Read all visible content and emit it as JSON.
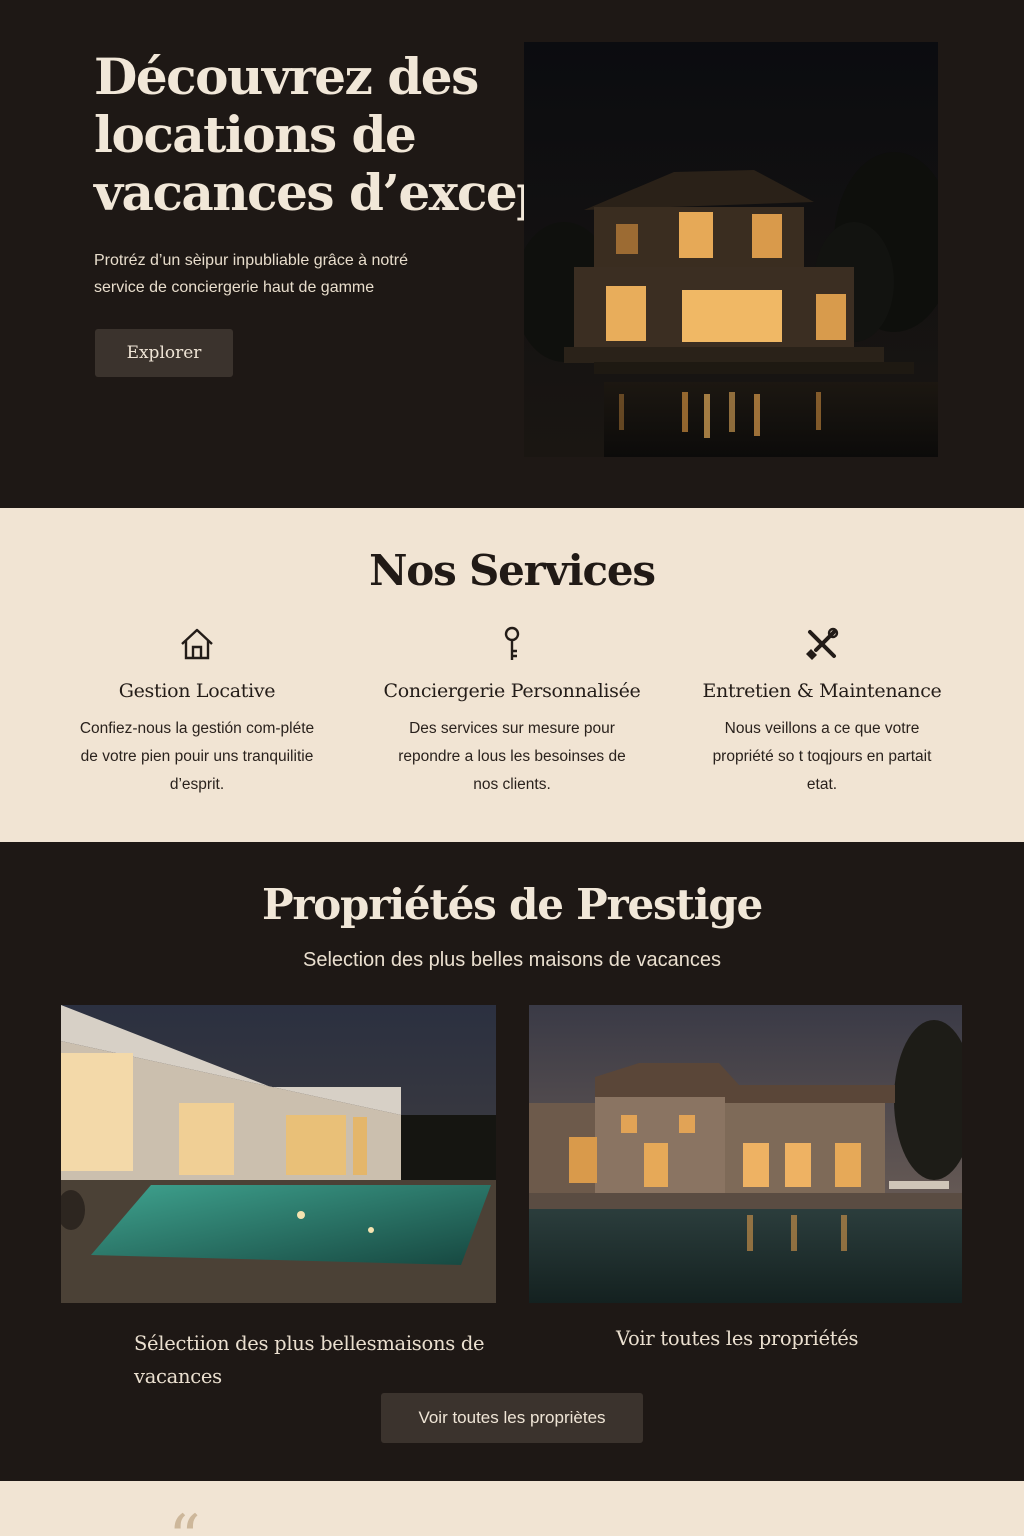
{
  "hero": {
    "title_line1": "Découvrez des",
    "title_line2": "locations de",
    "title_line3": "vacances d’exception",
    "subtitle_line1": "Protréz d’un sèipur inpubliable grâce à notré",
    "subtitle_line2": "service de conciergerie haut de gamme",
    "cta": "Explorer",
    "image_icon": "night-villa-photo"
  },
  "services": {
    "title": "Nos Services",
    "items": [
      {
        "icon": "house-icon",
        "title": "Gestion Locative",
        "desc": "Confiez-nous la gestión com-pléte de votre pien pouir uns tranquilitie d’esprit."
      },
      {
        "icon": "key-icon",
        "title": "Conciergerie Personnalisée",
        "desc": "Des services sur mesure pour repondre a lous les besoinses de nos clients."
      },
      {
        "icon": "tools-icon",
        "title": "Entretien & Maintenance",
        "desc": "Nous veillons a ce que votre propriété so t toqjours en partait etat."
      }
    ]
  },
  "properties": {
    "title": "Propriétés de Prestige",
    "subtitle": "Selection des plus belles maisons de vacances",
    "caption_left": "Sélectiion des plus bellesmaisons de vacances",
    "caption_right": "Voir toutes les propriétés",
    "cta": "Voir toutes les propriètes"
  },
  "testimonial": {
    "quote_mark": "“"
  },
  "colors": {
    "dark_bg": "#1e1815",
    "cream_bg": "#f1e4d3",
    "button_bg": "#3b332d",
    "text_light": "#efe5d6",
    "text_dark": "#231c18",
    "accent_gold": "#e0a95a"
  }
}
